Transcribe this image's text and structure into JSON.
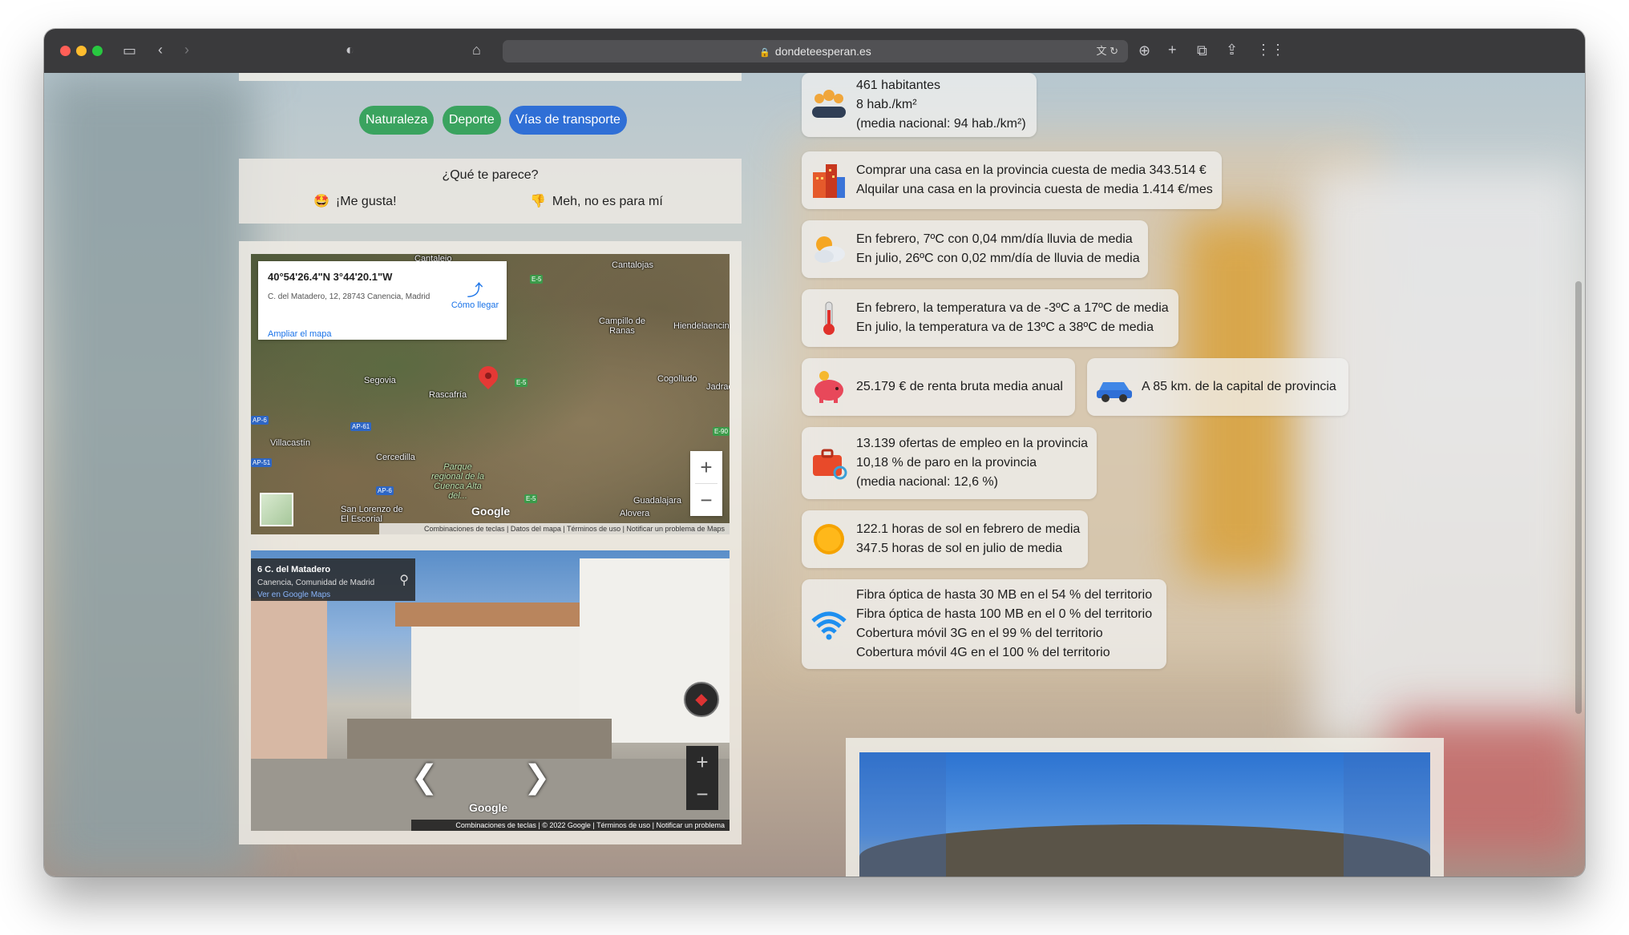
{
  "browser": {
    "url": "dondeteesperan.es"
  },
  "tags": [
    "Naturaleza",
    "Deporte",
    "Vías de transporte"
  ],
  "opinion": {
    "question": "¿Qué te parece?",
    "like_label": "¡Me gusta!",
    "dislike_label": "Meh, no es para mí"
  },
  "map": {
    "coords": "40°54'26.4\"N 3°44'20.1\"W",
    "address": "C. del Matadero, 12, 28743 Canencia, Madrid",
    "directions": "Cómo llegar",
    "enlarge": "Ampliar el mapa",
    "places": [
      "Cantalejo",
      "Cantalojas",
      "Campillo de Ranas",
      "Hiendelaencina",
      "Segovia",
      "Rascafría",
      "Cogolludo",
      "Jadraque",
      "Villacastín",
      "Cercedilla",
      "Parque regional de la Cuenca Alta del...",
      "San Lorenzo de El Escorial",
      "Guadalajara",
      "Alovera"
    ],
    "roads": [
      "E-5",
      "E-5",
      "AP-6",
      "AP-61",
      "AP-51",
      "AP-6",
      "E-5",
      "E-90"
    ],
    "footer": "Combinaciones de teclas | Datos del mapa | Términos de uso | Notificar un problema de Maps",
    "google": "Google"
  },
  "streetview": {
    "title": "6 C. del Matadero",
    "subtitle": "Canencia, Comunidad de Madrid",
    "link": "Ver en Google Maps",
    "footer": "Combinaciones de teclas | © 2022 Google | Términos de uso | Notificar un problema",
    "google": "Google"
  },
  "info": {
    "population": [
      "461 habitantes",
      "8 hab./km²",
      "(media nacional: 94 hab./km²)"
    ],
    "housing": [
      "Comprar una casa en la provincia cuesta de media 343.514 €",
      "Alquilar una casa en la provincia cuesta de media 1.414 €/mes"
    ],
    "rain": [
      "En febrero, 7ºC con 0,04 mm/día lluvia de media",
      "En julio, 26ºC con 0,02 mm/día de lluvia de media"
    ],
    "temperature": [
      "En febrero, la temperatura va de -3ºC a 17ºC de media",
      "En julio, la temperatura va de 13ºC a 38ºC de media"
    ],
    "income": "25.179 € de renta bruta media anual",
    "distance": "A 85 km. de la capital de provincia",
    "employment": [
      "13.139 ofertas de empleo en la provincia",
      "10,18 % de paro en la provincia",
      "(media nacional: 12,6 %)"
    ],
    "sun": [
      "122.1 horas de sol en febrero de media",
      "347.5 horas de sol en julio de media"
    ],
    "connectivity": [
      "Fibra óptica de hasta 30 MB en el 54 % del territorio",
      "Fibra óptica de hasta 100 MB en el 0 % del territorio",
      "Cobertura móvil 3G en el 99 % del territorio",
      "Cobertura móvil 4G en el 100 % del territorio"
    ]
  },
  "colors": {
    "tag_green": "#3aa35f",
    "tag_blue": "#2f6fd6",
    "link_blue": "#1a73e8"
  }
}
